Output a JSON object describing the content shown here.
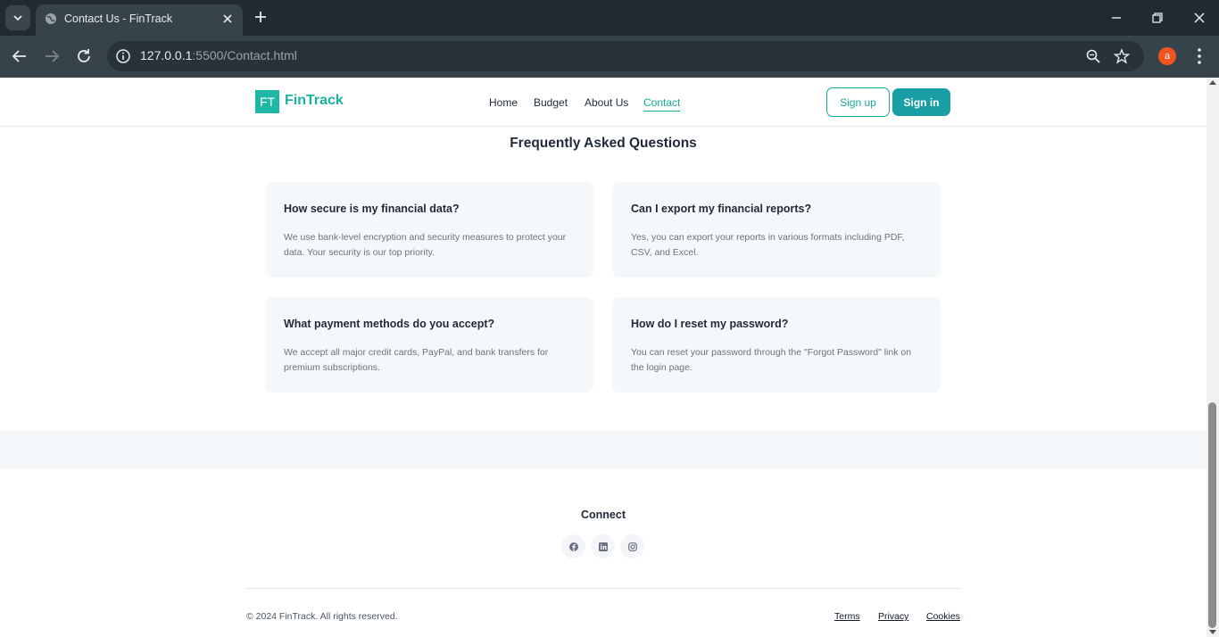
{
  "browser": {
    "tab_title": "Contact Us - FinTrack",
    "url_host": "127.0.0.1",
    "url_rest": ":5500/Contact.html",
    "profile_initial": "a"
  },
  "header": {
    "logo_badge": "FT",
    "logo_text": "FinTrack",
    "nav": [
      "Home",
      "Budget",
      "About Us",
      "Contact"
    ],
    "active_nav": "Contact",
    "signup_label": "Sign up",
    "signin_label": "Sign in"
  },
  "faq": {
    "title": "Frequently Asked Questions",
    "items": [
      {
        "q": "How secure is my financial data?",
        "a": "We use bank-level encryption and security measures to protect your data. Your security is our top priority."
      },
      {
        "q": "Can I export my financial reports?",
        "a": "Yes, you can export your reports in various formats including PDF, CSV, and Excel."
      },
      {
        "q": "What payment methods do you accept?",
        "a": "We accept all major credit cards, PayPal, and bank transfers for premium subscriptions."
      },
      {
        "q": "How do I reset my password?",
        "a": "You can reset your password through the \"Forgot Password\" link on the login page."
      }
    ]
  },
  "footer": {
    "connect_title": "Connect",
    "social": [
      "facebook-icon",
      "linkedin-icon",
      "instagram-icon"
    ],
    "copyright": "© 2024 FinTrack. All rights reserved.",
    "links": [
      "Terms",
      "Privacy",
      "Cookies"
    ]
  },
  "colors": {
    "brand": "#18b3a1",
    "signin_bg": "#1a9ea6",
    "card_bg": "#f5f8fb"
  }
}
